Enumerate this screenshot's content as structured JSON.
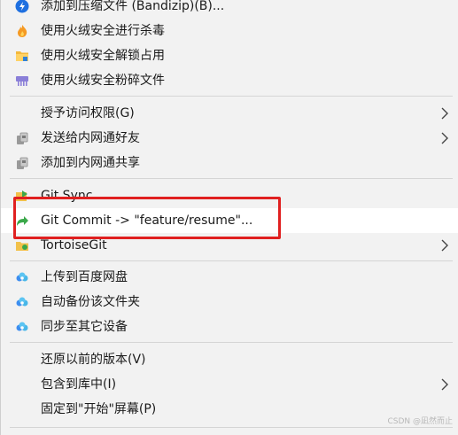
{
  "menu": {
    "items": [
      {
        "label": "添加到压缩文件 (Bandizip)(B)...",
        "icon": "bandizip-icon"
      },
      {
        "label": "使用火绒安全进行杀毒",
        "icon": "huorong-flame-icon"
      },
      {
        "label": "使用火绒安全解锁占用",
        "icon": "folder-lock-icon"
      },
      {
        "label": "使用火绒安全粉碎文件",
        "icon": "shredder-icon"
      },
      {
        "label": "授予访问权限(G)",
        "icon": "",
        "submenu": true
      },
      {
        "label": "发送给内网通好友",
        "icon": "lan-share-icon",
        "submenu": true
      },
      {
        "label": "添加到内网通共享",
        "icon": "lan-share-icon"
      },
      {
        "label": "Git Sync...",
        "icon": "git-sync-icon"
      },
      {
        "label": "Git Commit -> \"feature/resume\"...",
        "icon": "git-commit-arrow-icon"
      },
      {
        "label": "TortoiseGit",
        "icon": "tortoisegit-folder-icon",
        "submenu": true
      },
      {
        "label": "上传到百度网盘",
        "icon": "baidu-cloud-icon"
      },
      {
        "label": "自动备份该文件夹",
        "icon": "baidu-cloud-icon"
      },
      {
        "label": "同步至其它设备",
        "icon": "baidu-cloud-icon"
      },
      {
        "label": "还原以前的版本(V)",
        "icon": ""
      },
      {
        "label": "包含到库中(I)",
        "icon": "",
        "submenu": true
      },
      {
        "label": "固定到\"开始\"屏幕(P)",
        "icon": ""
      }
    ]
  },
  "watermark": "CSDN @凪然而止",
  "colors": {
    "menu_bg": "#f2f2f2",
    "highlight_bg": "#ffffff",
    "annotation_border": "#e02020"
  }
}
